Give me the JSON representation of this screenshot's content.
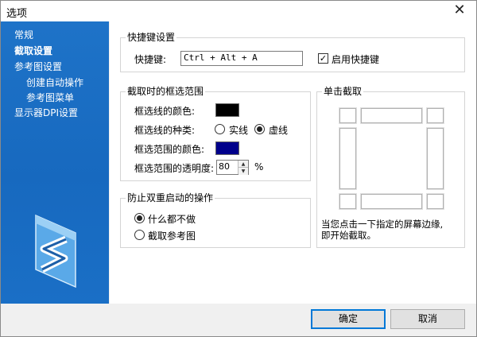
{
  "window": {
    "title": "选项",
    "close_glyph": "✕"
  },
  "sidebar": {
    "items": [
      {
        "label": "常规"
      },
      {
        "label": "截取设置",
        "active": true
      },
      {
        "label": "参考图设置"
      },
      {
        "label": "创建自动操作"
      },
      {
        "label": "参考图菜单"
      },
      {
        "label": "显示器DPI设置"
      }
    ]
  },
  "shortcut": {
    "group_title": "快捷键设置",
    "label": "快捷键:",
    "value": "Ctrl + Alt + A",
    "enable_label": "启用快捷键",
    "enabled": true,
    "check_glyph": "✓"
  },
  "frame": {
    "group_title": "截取时的框选范围",
    "line_color_label": "框选线的颜色:",
    "line_color": "#000000",
    "line_type_label": "框选线的种类:",
    "solid_label": "实线",
    "dashed_label": "虚线",
    "selected_type": "dashed",
    "area_color_label": "框选范围的颜色:",
    "area_color": "#00008b",
    "opacity_label": "框选范围的透明度:",
    "opacity_value": "80",
    "opacity_unit": "%"
  },
  "prevent": {
    "group_title": "防止双重启动的操作",
    "option1": "什么都不做",
    "option2": "截取参考图",
    "selected": "option1"
  },
  "single_click": {
    "group_title": "单击截取",
    "description_line1": "当您点击一下指定的屏幕边缘,",
    "description_line2": "即开始截取。"
  },
  "footer": {
    "ok_label": "确定",
    "cancel_label": "取消"
  },
  "colors": {
    "sidebar": "#1a6fc6",
    "accent": "#0078d7"
  }
}
